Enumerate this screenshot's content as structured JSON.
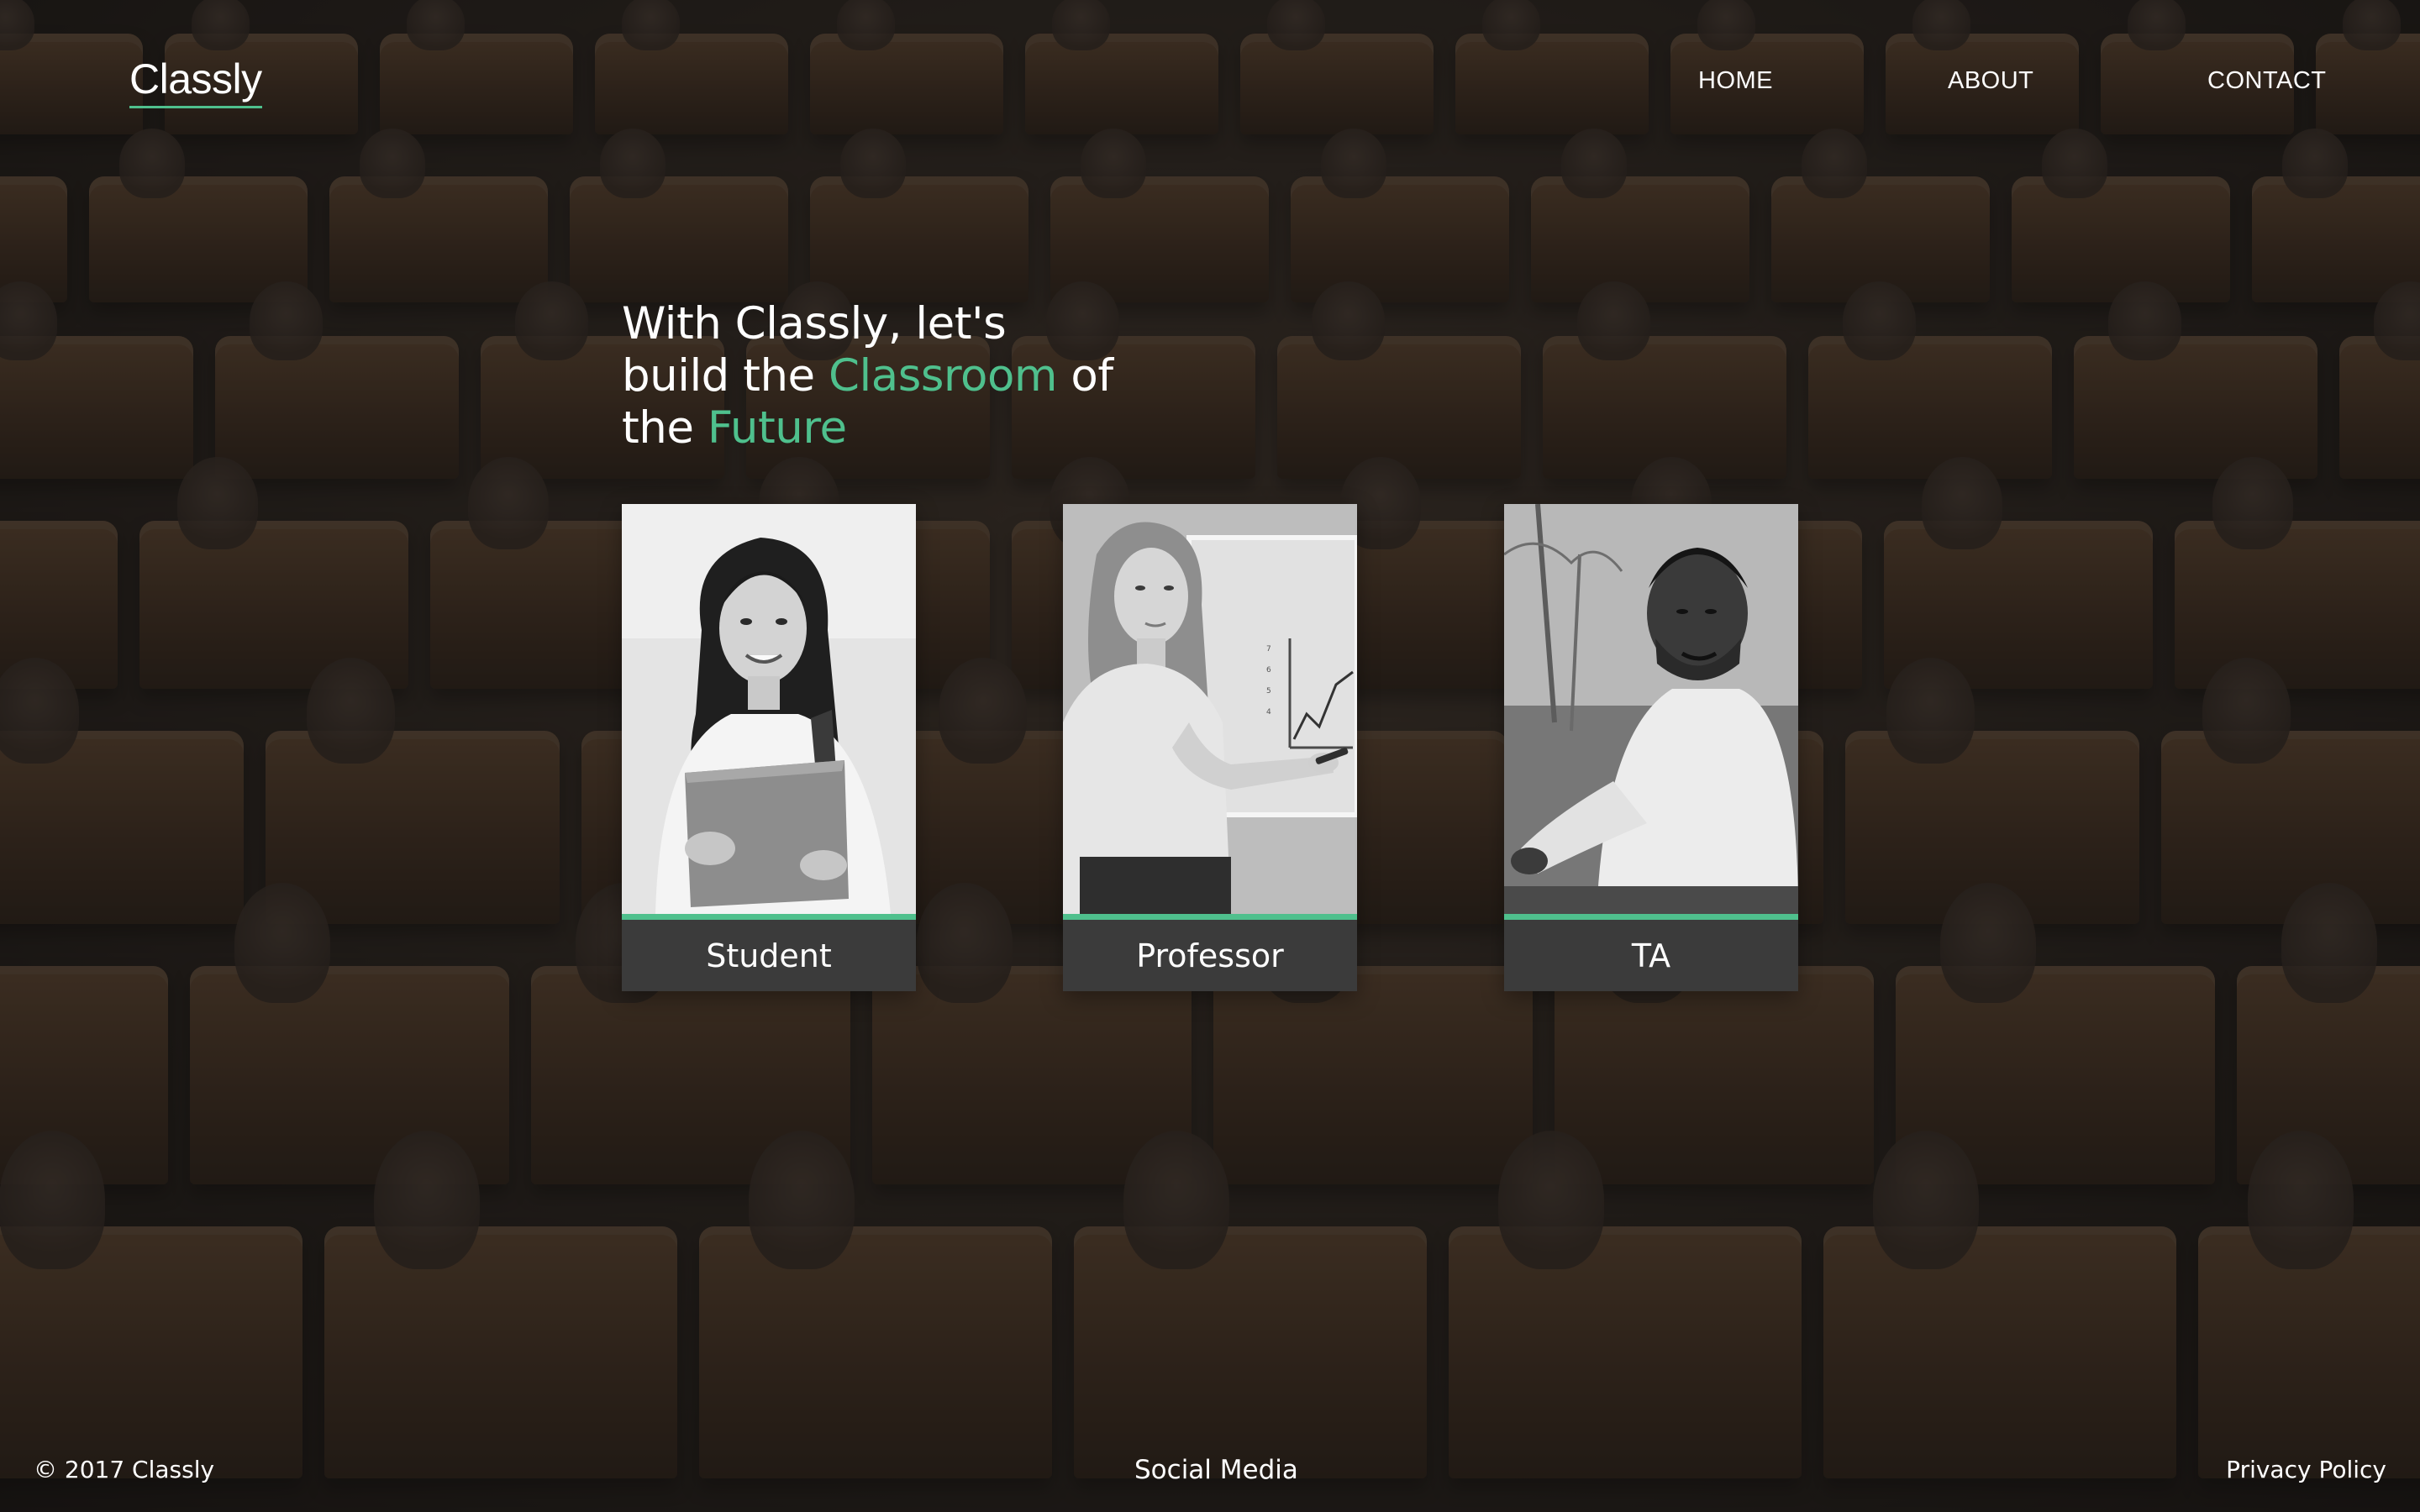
{
  "brand": {
    "logo_text": "Classly",
    "accent_color": "#4fc08d"
  },
  "nav": {
    "home": "HOME",
    "about": "ABOUT",
    "contact": "CONTACT"
  },
  "hero": {
    "line1": "With Classly, let's",
    "line2_pre": "build the ",
    "line2_accent": "Classroom",
    "line2_post": " of",
    "line3_pre": "the ",
    "line3_accent": "Future"
  },
  "cards": [
    {
      "label": "Student",
      "photo": "student-photo"
    },
    {
      "label": "Professor",
      "photo": "professor-photo"
    },
    {
      "label": "TA",
      "photo": "ta-photo"
    }
  ],
  "footer": {
    "copyright": "© 2017 Classly",
    "social": "Social Media",
    "privacy": "Privacy Policy"
  }
}
